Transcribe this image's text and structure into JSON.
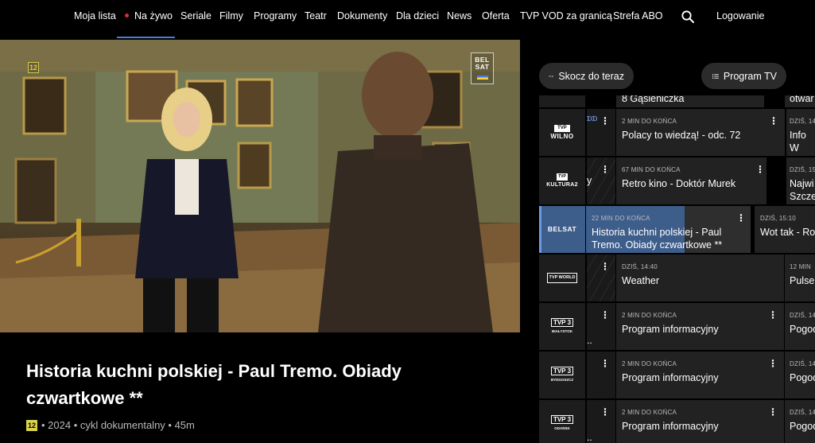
{
  "nav": {
    "items": [
      "Moja lista",
      "Na żywo",
      "Seriale",
      "Filmy",
      "Programy",
      "Teatr",
      "Dokumenty",
      "Dla dzieci",
      "News",
      "Oferta",
      "TVP VOD za granicą",
      "Strefa ABO"
    ],
    "login": "Logowanie",
    "active_item": "Na żywo",
    "accent_color": "#4d7cd6",
    "live_dot_color": "#e3263b"
  },
  "player": {
    "age_badge": "12",
    "channel_logo": "BEL SAT"
  },
  "program": {
    "title": "Historia kuchni polskiej - Paul Tremo. Obiady czwartkowe **",
    "age": "12",
    "meta": "• 2024 • cykl dokumentalny • 45m"
  },
  "buttons": {
    "jump": "Skocz do teraz",
    "guide": "Program TV"
  },
  "guide": {
    "top_row": {
      "current_title": "8 Gąsieniczka",
      "next_title": "otwar"
    },
    "rows": [
      {
        "channel": "TVP WILNO",
        "prev_title": "",
        "time": "2 MIN DO KOŃCA",
        "title": "Polacy to wiedzą! - odc. 72",
        "next_time": "DZIŚ, 14",
        "next_title": "Info W"
      },
      {
        "channel": "TVP KULTURA 2",
        "prev_title": "y",
        "time": "67 MIN DO KOŃCA",
        "title": "Retro kino - Doktór Murek",
        "next_time": "DZIŚ, 15",
        "next_title": "Najwi Szczep"
      },
      {
        "channel": "BELSAT",
        "prev_title": "",
        "time": "22 MIN DO KOŃCA",
        "title": "Historia kuchni polskiej - Paul Tremo. Obiady czwartkowe **",
        "next_time": "DZIŚ, 15:10",
        "next_title": "Wot tak - Roz",
        "progress": 0.6
      },
      {
        "channel": "TVP WORLD",
        "prev_title": "",
        "time": "DZIŚ, 14:40",
        "title": "Weather",
        "next_time": "12 MIN",
        "next_title": "Pulse"
      },
      {
        "channel": "TVP3 BIAŁYSTOK",
        "prev_title": "..",
        "time": "2 MIN DO KOŃCA",
        "title": "Program informacyjny",
        "next_time": "DZIŚ, 14",
        "next_title": "Pogod"
      },
      {
        "channel": "TVP3 BYDGOSZCZ",
        "prev_title": "",
        "time": "2 MIN DO KOŃCA",
        "title": "Program informacyjny",
        "next_time": "DZIŚ, 14",
        "next_title": "Pogod"
      },
      {
        "channel": "TVP3 GDAŃSK",
        "prev_title": "..",
        "time": "2 MIN DO KOŃCA",
        "title": "Program informacyjny",
        "next_time": "DZIŚ, 14",
        "next_title": "Pogod"
      }
    ]
  }
}
